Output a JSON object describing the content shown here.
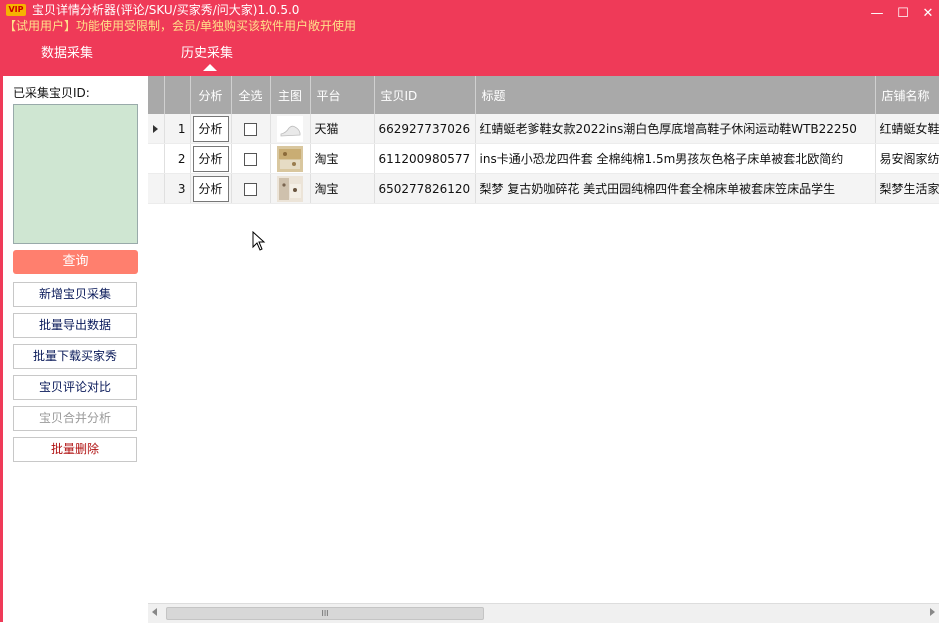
{
  "window": {
    "badge": "VIP",
    "title": "宝贝详情分析器(评论/SKU/买家秀/问大家)1.0.5.0",
    "notice_prefix": "【试用用户】",
    "notice_body": "功能使用受限制，会员/单独购买该软件用户敞开使用",
    "minimize_glyph": "—",
    "maximize_glyph": "☐",
    "close_glyph": "✕"
  },
  "tabs": [
    {
      "label": "数据采集",
      "active": false
    },
    {
      "label": "历史采集",
      "active": true
    }
  ],
  "sidebar": {
    "collected_label": "已采集宝贝ID:",
    "query_label": "查询",
    "buttons": [
      {
        "label": "新增宝贝采集",
        "state": "normal"
      },
      {
        "label": "批量导出数据",
        "state": "normal"
      },
      {
        "label": "批量下载买家秀",
        "state": "normal"
      },
      {
        "label": "宝贝评论对比",
        "state": "normal"
      },
      {
        "label": "宝贝合并分析",
        "state": "disabled"
      },
      {
        "label": "批量删除",
        "state": "danger"
      }
    ]
  },
  "grid": {
    "columns": [
      "分析",
      "全选",
      "主图",
      "平台",
      "宝贝ID",
      "标题",
      "店铺名称"
    ],
    "analyze_label": "分析",
    "rows": [
      {
        "index": "1",
        "platform": "天猫",
        "id": "662927737026",
        "title": "红蜻蜓老爹鞋女款2022ins潮白色厚底增高鞋子休闲运动鞋WTB22250",
        "shop": "红蜻蜓女鞋"
      },
      {
        "index": "2",
        "platform": "淘宝",
        "id": "611200980577",
        "title": "ins卡通小恐龙四件套 全棉纯棉1.5m男孩灰色格子床单被套北欧简约",
        "shop": "易安阁家纺"
      },
      {
        "index": "3",
        "platform": "淘宝",
        "id": "650277826120",
        "title": "梨梦 复古奶咖碎花 美式田园纯棉四件套全棉床单被套床笠床品学生",
        "shop": "梨梦生活家"
      }
    ]
  },
  "scrollbar": {
    "grip": "III"
  },
  "colors": {
    "brand": "#ef3a58",
    "query": "#ff7f6e",
    "header": "#a9a9a9",
    "id_box": "#cfe6d2"
  }
}
